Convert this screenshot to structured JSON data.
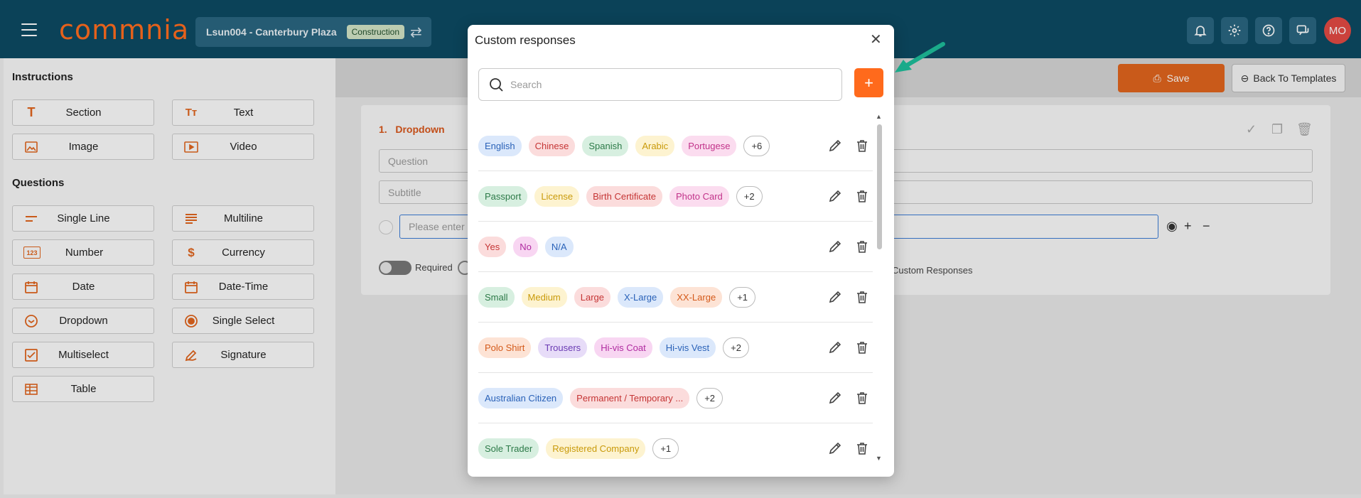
{
  "topbar": {
    "logo": "commnia",
    "project_name": "Lsun004 - Canterbury Plaza",
    "project_badge": "Construction",
    "avatar_initials": "MO"
  },
  "left_panel": {
    "instructions_title": "Instructions",
    "instructions": [
      "Section",
      "Text",
      "Image",
      "Video"
    ],
    "questions_title": "Questions",
    "questions": [
      "Single Line",
      "Multiline",
      "Number",
      "Currency",
      "Date",
      "Date-Time",
      "Dropdown",
      "Single Select",
      "Multiselect",
      "Signature",
      "Table"
    ]
  },
  "editor": {
    "save_label": "Save",
    "back_label": "Back To Templates",
    "question_number": "1.",
    "question_type": "Dropdown",
    "question_placeholder": "Question",
    "subtitle_placeholder": "Subtitle",
    "option_placeholder": "Please enter a",
    "required_label": "Required",
    "custom_responses_label": "Custom Responses"
  },
  "modal": {
    "title": "Custom responses",
    "search_placeholder": "Search",
    "rows": [
      {
        "tags": [
          {
            "text": "English",
            "bg": "#dbe8fb",
            "fg": "#2a62b8"
          },
          {
            "text": "Chinese",
            "bg": "#fbdcdc",
            "fg": "#c53535"
          },
          {
            "text": "Spanish",
            "bg": "#d7efe0",
            "fg": "#2c7a48"
          },
          {
            "text": "Arabic",
            "bg": "#fdf3d0",
            "fg": "#c99a0a"
          },
          {
            "text": "Portugese",
            "bg": "#fbdcef",
            "fg": "#c2338a"
          }
        ],
        "more": "+6"
      },
      {
        "tags": [
          {
            "text": "Passport",
            "bg": "#d7efe0",
            "fg": "#2c7a48"
          },
          {
            "text": "License",
            "bg": "#fdf3d0",
            "fg": "#c99a0a"
          },
          {
            "text": "Birth Certificate",
            "bg": "#fbdcdc",
            "fg": "#c53535"
          },
          {
            "text": "Photo Card",
            "bg": "#fbdcef",
            "fg": "#c2338a"
          }
        ],
        "more": "+2"
      },
      {
        "tags": [
          {
            "text": "Yes",
            "bg": "#fbdcdc",
            "fg": "#c53535"
          },
          {
            "text": "No",
            "bg": "#f8d6f2",
            "fg": "#b02ba0"
          },
          {
            "text": "N/A",
            "bg": "#dbe8fb",
            "fg": "#2a62b8"
          }
        ],
        "more": ""
      },
      {
        "tags": [
          {
            "text": "Small",
            "bg": "#d7efe0",
            "fg": "#2c7a48"
          },
          {
            "text": "Medium",
            "bg": "#fdf3d0",
            "fg": "#c99a0a"
          },
          {
            "text": "Large",
            "bg": "#fbdcdc",
            "fg": "#c53535"
          },
          {
            "text": "X-Large",
            "bg": "#dbe8fb",
            "fg": "#2a62b8"
          },
          {
            "text": "XX-Large",
            "bg": "#fde3d5",
            "fg": "#d45a1a"
          }
        ],
        "more": "+1"
      },
      {
        "tags": [
          {
            "text": "Polo Shirt",
            "bg": "#fde3d5",
            "fg": "#d45a1a"
          },
          {
            "text": "Trousers",
            "bg": "#e7dcf8",
            "fg": "#6a3ab3"
          },
          {
            "text": "Hi-vis Coat",
            "bg": "#f8d6f2",
            "fg": "#b02ba0"
          },
          {
            "text": "Hi-vis Vest",
            "bg": "#dbe8fb",
            "fg": "#2a62b8"
          }
        ],
        "more": "+2"
      },
      {
        "tags": [
          {
            "text": "Australian Citizen",
            "bg": "#dbe8fb",
            "fg": "#2a62b8"
          },
          {
            "text": "Permanent / Temporary ...",
            "bg": "#fbdcdc",
            "fg": "#c53535"
          }
        ],
        "more": "+2"
      },
      {
        "tags": [
          {
            "text": "Sole Trader",
            "bg": "#d7efe0",
            "fg": "#2c7a48"
          },
          {
            "text": "Registered Company",
            "bg": "#fdf3d0",
            "fg": "#c99a0a"
          }
        ],
        "more": "+1"
      }
    ]
  },
  "colors": {
    "brand_orange": "#ff6a1c",
    "topbar": "#0d4a62",
    "annotation_arrow": "#1aaa8a"
  }
}
